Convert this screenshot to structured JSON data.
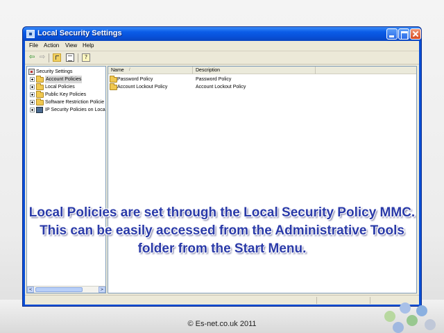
{
  "window": {
    "title": "Local Security Settings",
    "controls": {
      "minimize_icon": "minimize-icon",
      "maximize_icon": "maximize-icon",
      "close_icon": "close-icon"
    }
  },
  "menubar": {
    "items": [
      {
        "label": "File"
      },
      {
        "label": "Action"
      },
      {
        "label": "View"
      },
      {
        "label": "Help"
      }
    ]
  },
  "toolbar": {
    "back_symbol": "⇦",
    "forward_symbol": "⇨",
    "help_symbol": "?"
  },
  "tree": {
    "root": {
      "label": "Security Settings"
    },
    "items": [
      {
        "label": "Account Policies",
        "icon": "folder-icon",
        "selected": true
      },
      {
        "label": "Local Policies",
        "icon": "folder-icon"
      },
      {
        "label": "Public Key Policies",
        "icon": "folder-icon"
      },
      {
        "label": "Software Restriction Policie",
        "icon": "folder-icon"
      },
      {
        "label": "IP Security Policies on Loca",
        "icon": "monitor-icon"
      }
    ],
    "scroll": {
      "left_symbol": "<",
      "right_symbol": ">"
    }
  },
  "list": {
    "columns": [
      {
        "label": "Name"
      },
      {
        "label": "Description"
      },
      {
        "label": ""
      }
    ],
    "sort_symbol": "/",
    "rows": [
      {
        "name": "Password Policy",
        "description": "Password Policy"
      },
      {
        "name": "Account Lockout Policy",
        "description": "Account Lockout Policy"
      }
    ]
  },
  "slide": {
    "caption": "Local Policies are set through the Local Security Policy MMC. This can be easily accessed from the Administrative Tools folder from the Start Menu.",
    "footer": "© Es-net.co.uk 2011"
  },
  "colors": {
    "titlebar": "#0a5ce8",
    "caption_text": "#2a3aa8",
    "dots": [
      "#a8c0e8",
      "#8ab0e0",
      "#b8d8a0",
      "#98c890",
      "#c0c8d8",
      "#a0b8e0"
    ]
  }
}
